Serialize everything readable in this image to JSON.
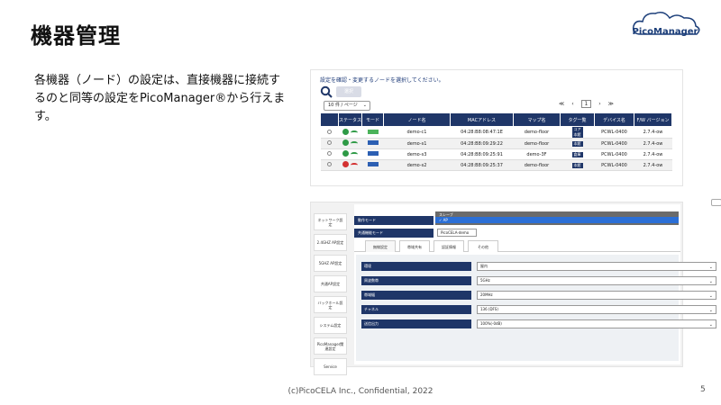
{
  "slide": {
    "title": "機器管理",
    "body": "各機器（ノード）の設定は、直接機器に接続するのと同等の設定をPicoManager®から行えます。",
    "footer": "(c)PicoCELA Inc., Confidential, 2022",
    "page_number": "5",
    "logo_text": "PicoManager"
  },
  "node_list": {
    "instruction": "設定を確認・変更するノードを選択してください。",
    "search_label": "選択",
    "per_page": "10 件 / ページ",
    "pager": {
      "first": "≪",
      "prev": "‹",
      "current": "1",
      "next": "›",
      "last": "≫"
    },
    "columns": [
      "",
      "ステータス",
      "モード",
      "ノード名",
      "MACアドレス",
      "マップ名",
      "タグ一覧",
      "デバイス名",
      "F/W バージョン"
    ],
    "rows": [
      {
        "status": "green",
        "wifi": "green",
        "mode": "green",
        "name": "demo-c1",
        "mac": "04:28:B8:08:47:1E",
        "map": "demo-floor",
        "tags": [
          "コア",
          "本館"
        ],
        "device": "PCWL-0400",
        "fw": "2.7.4-ow"
      },
      {
        "status": "green",
        "wifi": "green",
        "mode": "blue",
        "name": "demo-s1",
        "mac": "04:28:B8:09:29:22",
        "map": "demo-floor",
        "tags": [
          "本館"
        ],
        "device": "PCWL-0400",
        "fw": "2.7.4-ow"
      },
      {
        "status": "green",
        "wifi": "green",
        "mode": "blue",
        "name": "demo-s3",
        "mac": "04:28:B8:09:25:91",
        "map": "demo-3F",
        "tags": [
          "倉庫"
        ],
        "device": "PCWL-0400",
        "fw": "2.7.4-ow"
      },
      {
        "status": "red",
        "wifi": "red",
        "mode": "blue",
        "name": "demo-s2",
        "mac": "04:28:B8:09:25:37",
        "map": "demo-floor",
        "tags": [
          "本館"
        ],
        "device": "PCWL-0400",
        "fw": "2.7.4-ow"
      }
    ]
  },
  "node_settings": {
    "sidebar": [
      "ネットワーク設定",
      "2.4GHZ AP設定",
      "5GHZ AP設定",
      "共通AP設定",
      "バックホール設定",
      "システム設定",
      "PicoManager関連設定",
      "Service"
    ],
    "mode_label": "動作モード",
    "dropdown_options": [
      "スレーブ",
      "✓ AP"
    ],
    "common_label": "共通機能モード",
    "common_value": "PicoCELA-demo",
    "tabs": [
      "無線設定",
      "帯域共有",
      "認証情報",
      "その他"
    ],
    "fields": [
      {
        "label": "環境",
        "value": "屋内"
      },
      {
        "label": "周波数帯",
        "value": "5GHz"
      },
      {
        "label": "帯域幅",
        "value": "20MHz"
      },
      {
        "label": "チャネル",
        "value": "136 (DFS)"
      },
      {
        "label": "送信出力",
        "value": "100%(-0dB)"
      }
    ]
  }
}
